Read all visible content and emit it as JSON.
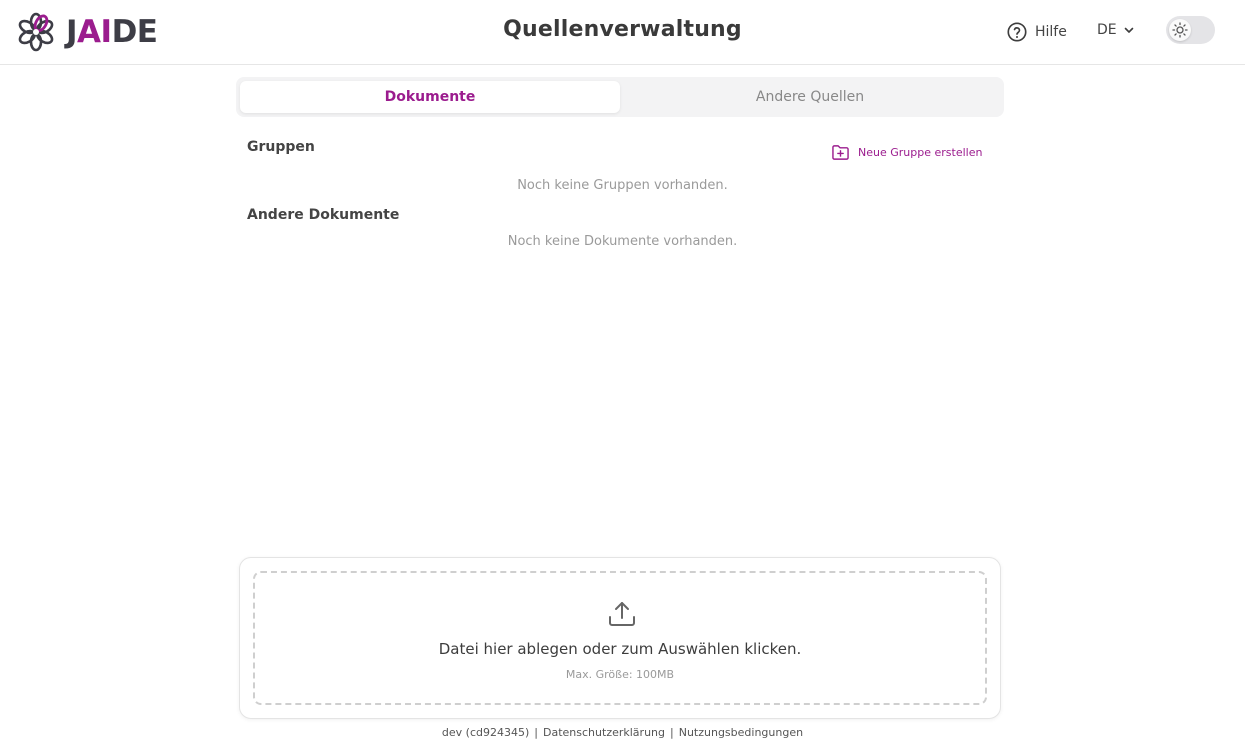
{
  "brand": {
    "logo_prefix": "J",
    "logo_accent": "AI",
    "logo_suffix": "DE",
    "accent_color": "#9b1c8e",
    "dark_color": "#3d3d46"
  },
  "header": {
    "title": "Quellenverwaltung",
    "help_label": "Hilfe",
    "help_icon": "question-circle-icon",
    "language": "DE",
    "language_icon": "chevron-down-icon",
    "theme_toggle_icon": "sun-icon"
  },
  "tabs": [
    {
      "label": "Dokumente",
      "active": true
    },
    {
      "label": "Andere Quellen",
      "active": false
    }
  ],
  "groups": {
    "heading": "Gruppen",
    "new_group_label": "Neue Gruppe erstellen",
    "new_group_icon": "folder-plus-icon",
    "empty_text": "Noch keine Gruppen vorhanden."
  },
  "documents": {
    "heading": "Andere Dokumente",
    "empty_text": "Noch keine Dokumente vorhanden."
  },
  "upload": {
    "icon": "upload-icon",
    "main_text": "Datei hier ablegen oder zum Auswählen klicken.",
    "sub_text": "Max. Größe: 100MB"
  },
  "footer": {
    "version": "dev (cd924345)",
    "privacy": "Datenschutzerklärung",
    "terms": "Nutzungsbedingungen",
    "separator": "|"
  }
}
